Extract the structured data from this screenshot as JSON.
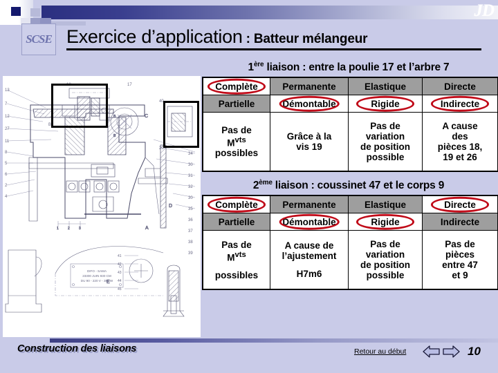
{
  "header": {
    "logo_monogram": "SCSE",
    "brand_logo": "JD",
    "title_main": "Exercice d’application",
    "title_sub": " : Batteur mélangeur"
  },
  "drawing": {
    "name": "batteur-melangeur-cross-section",
    "plate_text_line1": "DIFO - SAMA",
    "plate_text_line2": "23300 JUIN 930 CM",
    "plate_text_line3": "DU 90 - 220 V - 380 W",
    "view_labels": [
      "A",
      "B",
      "C",
      "D",
      "E"
    ]
  },
  "sections": [
    {
      "id": "liaison-1",
      "title_prefix": "1",
      "title_sup": "ère",
      "title_rest": " liaison : entre la poulie 17 et l’arbre 7",
      "rows": [
        [
          {
            "label": "Complète",
            "bg": "white",
            "circled": true
          },
          {
            "label": "Permanente",
            "bg": "gray",
            "circled": false
          },
          {
            "label": "Elastique",
            "bg": "gray",
            "circled": false
          },
          {
            "label": "Directe",
            "bg": "gray",
            "circled": false
          }
        ],
        [
          {
            "label": "Partielle",
            "bg": "gray",
            "circled": false
          },
          {
            "label": "Démontable",
            "bg": "white",
            "circled": true
          },
          {
            "label": "Rigide",
            "bg": "white",
            "circled": true
          },
          {
            "label": "Indirecte",
            "bg": "white",
            "circled": true
          }
        ]
      ],
      "justifications": [
        {
          "lines": [
            "Pas de",
            "M<sup>vts</sup>",
            "possibles"
          ]
        },
        {
          "lines": [
            "Grâce à la",
            "vis 19"
          ]
        },
        {
          "lines": [
            "Pas de",
            "variation",
            "de position",
            "possible"
          ]
        },
        {
          "lines": [
            "A cause",
            "des",
            "pièces 18,",
            "19 et 26"
          ]
        }
      ]
    },
    {
      "id": "liaison-2",
      "title_prefix": "2",
      "title_sup": "ème",
      "title_rest": " liaison : coussinet 47 et le corps 9",
      "rows": [
        [
          {
            "label": "Complète",
            "bg": "white",
            "circled": true
          },
          {
            "label": "Permanente",
            "bg": "gray",
            "circled": false
          },
          {
            "label": "Elastique",
            "bg": "gray",
            "circled": false
          },
          {
            "label": "Directe",
            "bg": "white",
            "circled": true
          }
        ],
        [
          {
            "label": "Partielle",
            "bg": "gray",
            "circled": false
          },
          {
            "label": "Démontable",
            "bg": "white",
            "circled": true
          },
          {
            "label": "Rigide",
            "bg": "white",
            "circled": true
          },
          {
            "label": "Indirecte",
            "bg": "gray",
            "circled": false
          }
        ]
      ],
      "justifications": [
        {
          "lines": [
            "Pas de",
            "M<sup>vts</sup>",
            "",
            "possibles"
          ]
        },
        {
          "lines": [
            "A cause de",
            "l’ajustement",
            "",
            "H7m6"
          ]
        },
        {
          "lines": [
            "Pas de",
            "variation",
            "de position",
            "possible"
          ]
        },
        {
          "lines": [
            "Pas de",
            "pièces",
            "entre 47",
            "et 9"
          ]
        }
      ]
    }
  ],
  "footer": {
    "title": "Construction des liaisons",
    "back_link": "Retour au début",
    "prev_arrow": "left-arrow-icon",
    "next_arrow": "right-arrow-icon",
    "page_number": "10"
  },
  "colors": {
    "background": "#c9cbe8",
    "cell_gray": "#9e9e9e",
    "cell_white": "#ffffff",
    "circle_red": "#c00a18",
    "bar_dark_blue": "#2b2f80"
  }
}
